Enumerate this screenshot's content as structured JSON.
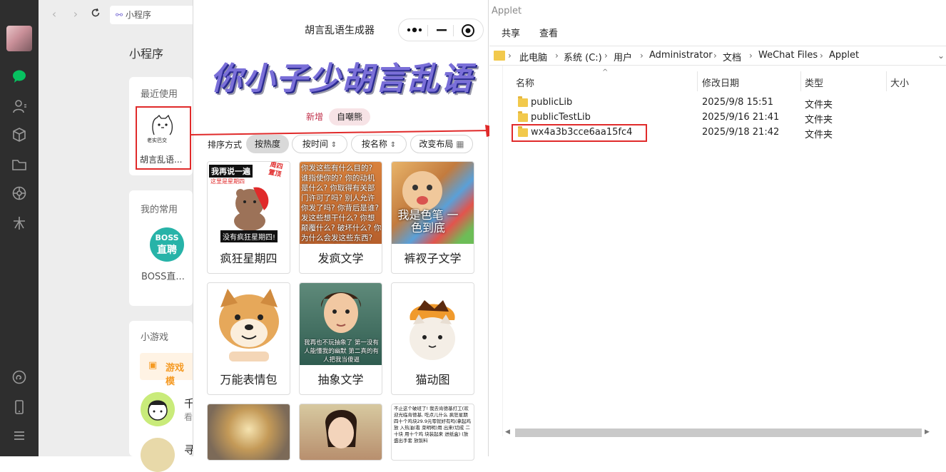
{
  "wechat_sidebar": {
    "icons": [
      "chat-icon",
      "contacts-icon",
      "box-icon",
      "folder-icon",
      "moments-icon",
      "star-icon",
      "miniprogram-icon",
      "phone-icon",
      "menu-icon"
    ],
    "accent": "#07c160"
  },
  "mini_program_panel": {
    "address": "小程序",
    "title": "小程序",
    "recent_label": "最近使用",
    "recent_item": {
      "name": "胡言乱语...",
      "logo_text": "老实巴交"
    },
    "frequent_label": "我的常用",
    "frequent_item": {
      "name": "BOSS直...",
      "logo_top": "BOSS",
      "logo_bottom": "直聘"
    },
    "games_label": "小游戏",
    "games_button": "游戏模",
    "game_item_1": {
      "title": "千",
      "subtitle": "看"
    },
    "game_item_2": {
      "title": "寻"
    }
  },
  "mini_program_window": {
    "title": "胡言乱语生成器",
    "banner": "你小子少胡言乱语",
    "tags": [
      "新增",
      "自嘲熊"
    ],
    "sort_label": "排序方式",
    "sort_buttons": [
      "按热度",
      "按时间",
      "按名称",
      "改变布局"
    ],
    "tiles": [
      {
        "caption": "疯狂星期四",
        "img_text": "我再说一遍",
        "img_sub": "这里是星期四",
        "badge": "周四 置顶",
        "bottom": "没有疯狂星期四!"
      },
      {
        "caption": "发疯文学",
        "img_text": "你发这些有什么目的? 谁指使你的? 你的动机是什么? 你取得有关部门许可了吗? 别人允许你发了吗? 你背后是谁? 发这些想干什么? 你想颠覆什么? 破坏什么? 你为什么会发这些东西? 是什么心态? 你用"
      },
      {
        "caption": "裤衩子文学",
        "img_text": "我是色笔 一色到底"
      },
      {
        "caption": "万能表情包"
      },
      {
        "caption": "抽象文学",
        "img_text": "我再也不玩抽象了 第一没有人能懂我的幽默 第二真的有人把我当傻逼"
      },
      {
        "caption": "猫动图"
      },
      {
        "caption": ""
      },
      {
        "caption": ""
      },
      {
        "caption": "",
        "img_text": "不止这个破班了! 我去肯德基打工(欢迎光临肯德基, 吃点儿什么 疯狂星期四十个鸡块29.9元零就好有吗(拿起鸡放 入热油(看 菜明明)用 出来(切成 二十块 用十个鸡 块装起来 进纸盒) (放 盛出手套 放饭料"
      }
    ]
  },
  "explorer": {
    "window_title": "Applet",
    "menu": [
      "共享",
      "查看"
    ],
    "breadcrumb": [
      "此电脑",
      "系统 (C:)",
      "用户",
      "Administrator",
      "文档",
      "WeChat Files",
      "Applet"
    ],
    "columns": [
      "名称",
      "修改日期",
      "类型",
      "大小"
    ],
    "files": [
      {
        "name": "publicLib",
        "date": "2025/9/8 15:51",
        "type": "文件夹"
      },
      {
        "name": "publicTestLib",
        "date": "2025/9/16 21:41",
        "type": "文件夹"
      },
      {
        "name": "wx4a3b3cce6aa15fc4",
        "date": "2025/9/18 21:42",
        "type": "文件夹"
      }
    ],
    "highlight_color": "#e02a2a",
    "folder_color": "#f2c94c"
  }
}
